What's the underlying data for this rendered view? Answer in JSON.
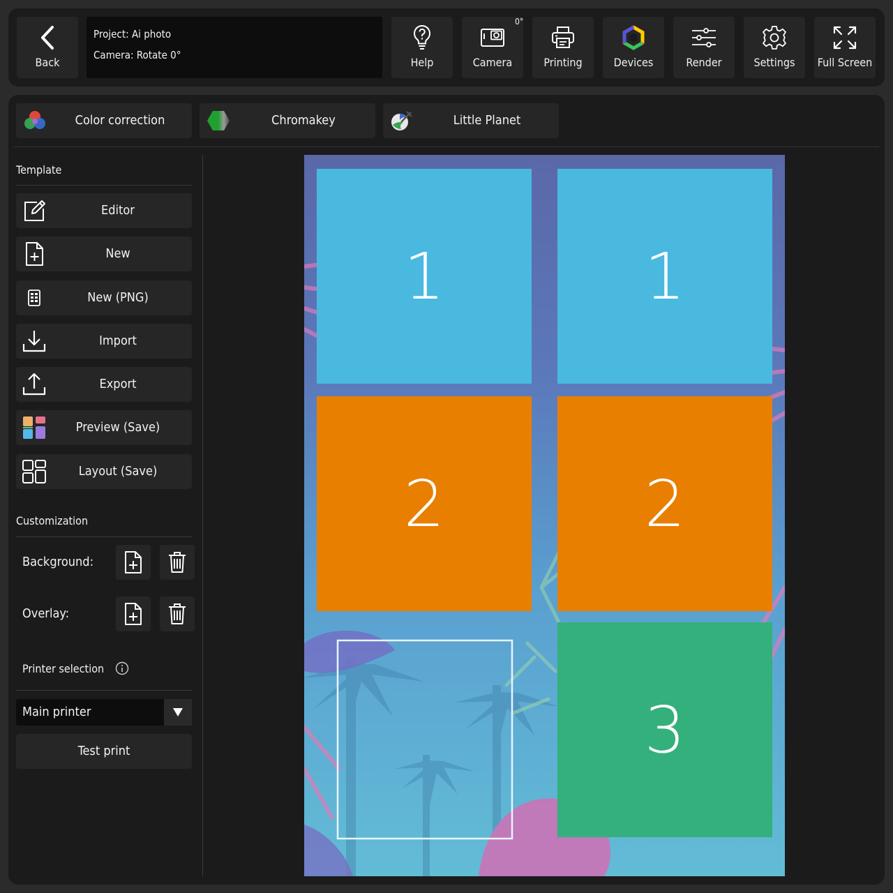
{
  "topbar": {
    "back_label": "Back",
    "project_line": "Project: Ai photo",
    "camera_line": "Camera: Rotate 0°",
    "camera_angle": "0°",
    "buttons": [
      {
        "label": "Help",
        "icon": "help-icon"
      },
      {
        "label": "Camera",
        "icon": "camera-icon"
      },
      {
        "label": "Printing",
        "icon": "printer-icon"
      },
      {
        "label": "Devices",
        "icon": "devices-icon"
      },
      {
        "label": "Render",
        "icon": "sliders-icon"
      },
      {
        "label": "Settings",
        "icon": "gear-icon"
      },
      {
        "label": "Full Screen",
        "icon": "fullscreen-icon"
      }
    ]
  },
  "tabs": [
    {
      "label": "Color correction",
      "icon": "color-correction-icon"
    },
    {
      "label": "Chromakey",
      "icon": "chromakey-icon"
    },
    {
      "label": "Little Planet",
      "icon": "little-planet-icon"
    }
  ],
  "sidebar": {
    "template_title": "Template",
    "template_buttons": [
      {
        "label": "Editor",
        "icon": "edit-icon"
      },
      {
        "label": "New",
        "icon": "new-file-icon"
      },
      {
        "label": "New (PNG)",
        "icon": "grid-file-icon"
      },
      {
        "label": "Import",
        "icon": "import-icon"
      },
      {
        "label": "Export",
        "icon": "export-icon"
      },
      {
        "label": "Preview (Save)",
        "icon": "preview-tiles-icon"
      },
      {
        "label": "Layout (Save)",
        "icon": "layout-icon"
      }
    ],
    "customization_title": "Customization",
    "background_label": "Background:",
    "overlay_label": "Overlay:",
    "printer_selection_label": "Printer selection",
    "printer_value": "Main printer",
    "test_print_label": "Test print"
  },
  "canvas": {
    "slots": [
      "1",
      "1",
      "2",
      "2",
      "3"
    ],
    "slot_colors": [
      "#49b9e0",
      "#49b9e0",
      "#e87f00",
      "#e87f00",
      "#34b07c"
    ]
  }
}
